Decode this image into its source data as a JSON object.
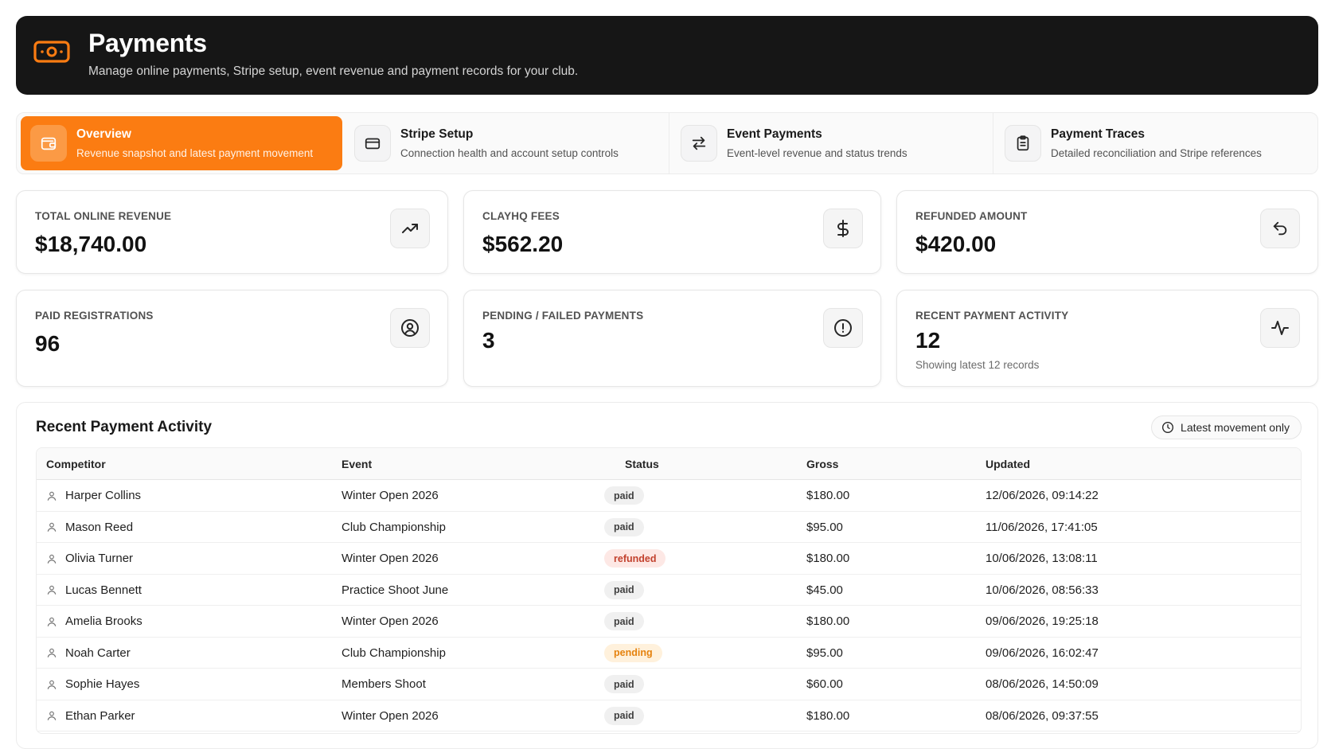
{
  "header": {
    "title": "Payments",
    "subtitle": "Manage online payments, Stripe setup, event revenue and payment records for your club.",
    "icon": "cash-icon",
    "accent": "#fb7c12"
  },
  "tabs": [
    {
      "label": "Overview",
      "description": "Revenue snapshot and latest payment movement",
      "icon": "wallet-icon",
      "active": true
    },
    {
      "label": "Stripe Setup",
      "description": "Connection health and account setup controls",
      "icon": "credit-card-icon",
      "active": false
    },
    {
      "label": "Event Payments",
      "description": "Event-level revenue and status trends",
      "icon": "arrows-swap-icon",
      "active": false
    },
    {
      "label": "Payment Traces",
      "description": "Detailed reconciliation and Stripe references",
      "icon": "clipboard-icon",
      "active": false
    }
  ],
  "stats": [
    {
      "label": "TOTAL ONLINE REVENUE",
      "value": "$18,740.00",
      "icon": "trending-up-icon"
    },
    {
      "label": "CLAYHQ FEES",
      "value": "$562.20",
      "icon": "dollar-icon"
    },
    {
      "label": "REFUNDED AMOUNT",
      "value": "$420.00",
      "icon": "undo-icon"
    },
    {
      "label": "PAID REGISTRATIONS",
      "value": "96",
      "icon": "user-circle-icon"
    },
    {
      "label": "PENDING / FAILED PAYMENTS",
      "value": "3",
      "icon": "alert-circle-icon"
    },
    {
      "label": "RECENT PAYMENT ACTIVITY",
      "value": "12",
      "note": "Showing latest 12 records",
      "icon": "activity-icon"
    }
  ],
  "activity": {
    "title": "Recent Payment Activity",
    "filter_label": "Latest movement only",
    "columns": [
      "Competitor",
      "Event",
      "Status",
      "Gross",
      "Updated"
    ],
    "rows": [
      {
        "competitor": "Harper Collins",
        "event": "Winter Open 2026",
        "status": "paid",
        "gross": "$180.00",
        "updated": "12/06/2026, 09:14:22"
      },
      {
        "competitor": "Mason Reed",
        "event": "Club Championship",
        "status": "paid",
        "gross": "$95.00",
        "updated": "11/06/2026, 17:41:05"
      },
      {
        "competitor": "Olivia Turner",
        "event": "Winter Open 2026",
        "status": "refunded",
        "gross": "$180.00",
        "updated": "10/06/2026, 13:08:11"
      },
      {
        "competitor": "Lucas Bennett",
        "event": "Practice Shoot June",
        "status": "paid",
        "gross": "$45.00",
        "updated": "10/06/2026, 08:56:33"
      },
      {
        "competitor": "Amelia Brooks",
        "event": "Winter Open 2026",
        "status": "paid",
        "gross": "$180.00",
        "updated": "09/06/2026, 19:25:18"
      },
      {
        "competitor": "Noah Carter",
        "event": "Club Championship",
        "status": "pending",
        "gross": "$95.00",
        "updated": "09/06/2026, 16:02:47"
      },
      {
        "competitor": "Sophie Hayes",
        "event": "Members Shoot",
        "status": "paid",
        "gross": "$60.00",
        "updated": "08/06/2026, 14:50:09"
      },
      {
        "competitor": "Ethan Parker",
        "event": "Winter Open 2026",
        "status": "paid",
        "gross": "$180.00",
        "updated": "08/06/2026, 09:37:55"
      }
    ]
  }
}
